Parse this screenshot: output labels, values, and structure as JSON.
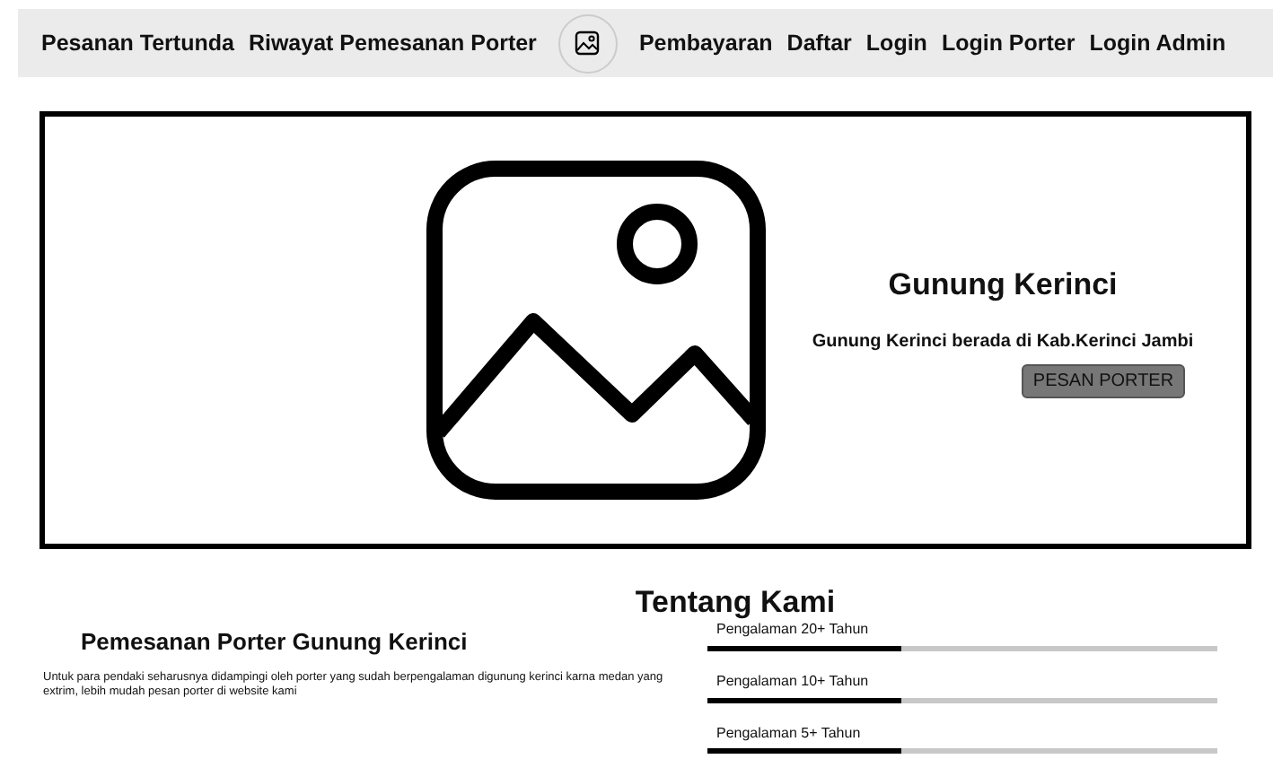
{
  "nav": {
    "left": [
      {
        "label": "Pesanan Tertunda"
      },
      {
        "label": "Riwayat Pemesanan Porter"
      }
    ],
    "right": [
      {
        "label": "Pembayaran"
      },
      {
        "label": "Daftar"
      },
      {
        "label": "Login"
      },
      {
        "label": "Login Porter"
      },
      {
        "label": "Login Admin"
      }
    ]
  },
  "hero": {
    "title": "Gunung Kerinci",
    "subtitle": "Gunung Kerinci berada di Kab.Kerinci Jambi",
    "button": "PESAN PORTER"
  },
  "about": {
    "heading": "Tentang Kami",
    "title": "Pemesanan Porter Gunung Kerinci",
    "text": "Untuk para pendaki seharusnya didampingi oleh porter yang sudah berpengalaman digunung kerinci karna medan yang extrim, lebih mudah pesan porter di website kami",
    "skills": [
      {
        "label": "Pengalaman 20+ Tahun",
        "level": 0.38
      },
      {
        "label": "Pengalaman 10+ Tahun",
        "level": 0.38
      },
      {
        "label": "Pengalaman 5+ Tahun",
        "level": 0.38
      }
    ]
  }
}
